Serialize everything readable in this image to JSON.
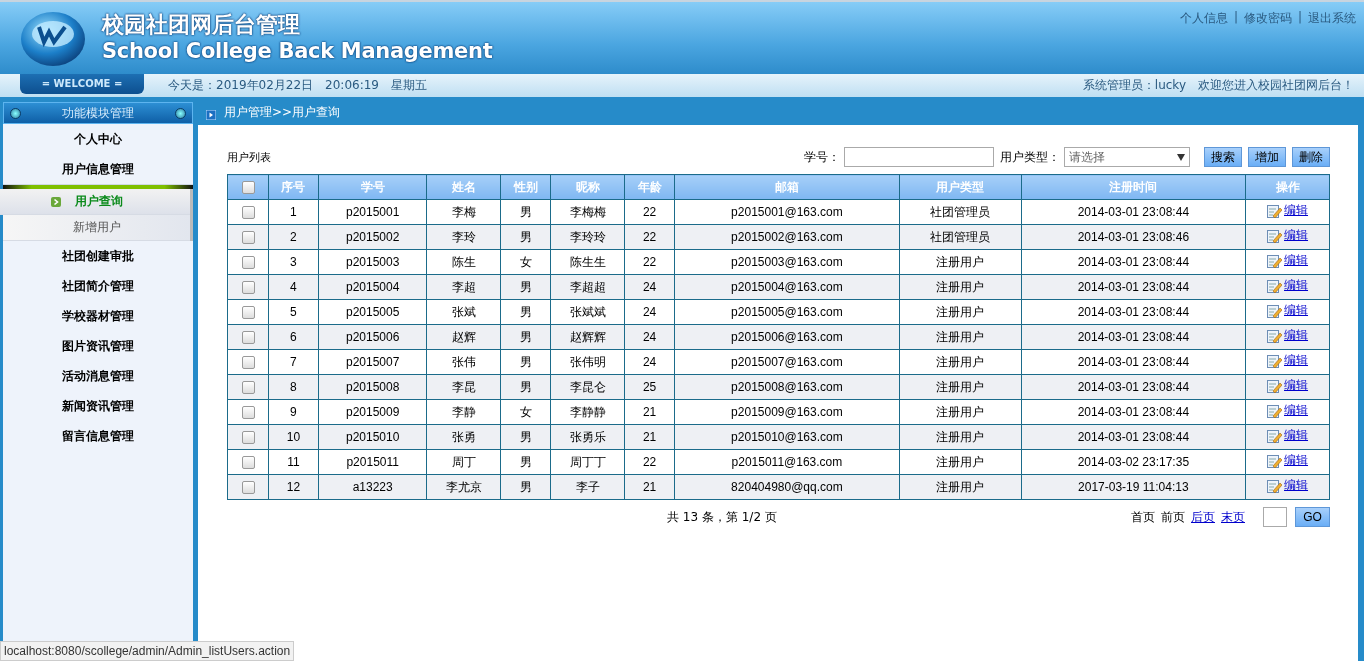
{
  "header": {
    "title_cn": "校园社团网后台管理",
    "title_en": "School College Back Management",
    "links": [
      "个人信息",
      "修改密码",
      "退出系统"
    ],
    "separator": "|"
  },
  "info_bar": {
    "welcome": "= WELCOME =",
    "date": "今天是：2019年02月22日　20:06:19　星期五",
    "user": "系统管理员：lucky　欢迎您进入校园社团网后台！"
  },
  "sidebar": {
    "title": "功能模块管理",
    "items": [
      {
        "label": "个人中心",
        "expanded": false
      },
      {
        "label": "用户信息管理",
        "expanded": true,
        "children": [
          {
            "label": "用户查询",
            "selected": true
          },
          {
            "label": "新增用户",
            "selected": false
          }
        ]
      },
      {
        "label": "社团创建审批",
        "expanded": false
      },
      {
        "label": "社团简介管理",
        "expanded": false
      },
      {
        "label": "学校器材管理",
        "expanded": false
      },
      {
        "label": "图片资讯管理",
        "expanded": false
      },
      {
        "label": "活动消息管理",
        "expanded": false
      },
      {
        "label": "新闻资讯管理",
        "expanded": false
      },
      {
        "label": "留言信息管理",
        "expanded": false
      }
    ]
  },
  "breadcrumb": "用户管理>>用户查询",
  "list_title": "用户列表",
  "search": {
    "id_label": "学号：",
    "type_label": "用户类型：",
    "type_placeholder": "请选择",
    "buttons": [
      "搜索",
      "增加",
      "删除"
    ]
  },
  "table": {
    "select_all_checked": false,
    "columns": [
      "序号",
      "学号",
      "姓名",
      "性别",
      "昵称",
      "年龄",
      "邮箱",
      "用户类型",
      "注册时间",
      "操作"
    ],
    "rows": [
      {
        "checked": false,
        "cells": [
          "1",
          "p2015001",
          "李梅",
          "男",
          "李梅梅",
          "22",
          "p2015001@163.com",
          "社团管理员",
          "2014-03-01 23:08:44"
        ],
        "action": "编辑"
      },
      {
        "checked": false,
        "cells": [
          "2",
          "p2015002",
          "李玲",
          "男",
          "李玲玲",
          "22",
          "p2015002@163.com",
          "社团管理员",
          "2014-03-01 23:08:46"
        ],
        "action": "编辑"
      },
      {
        "checked": false,
        "cells": [
          "3",
          "p2015003",
          "陈生",
          "女",
          "陈生生",
          "22",
          "p2015003@163.com",
          "注册用户",
          "2014-03-01 23:08:44"
        ],
        "action": "编辑"
      },
      {
        "checked": false,
        "cells": [
          "4",
          "p2015004",
          "李超",
          "男",
          "李超超",
          "24",
          "p2015004@163.com",
          "注册用户",
          "2014-03-01 23:08:44"
        ],
        "action": "编辑"
      },
      {
        "checked": false,
        "cells": [
          "5",
          "p2015005",
          "张斌",
          "男",
          "张斌斌",
          "24",
          "p2015005@163.com",
          "注册用户",
          "2014-03-01 23:08:44"
        ],
        "action": "编辑"
      },
      {
        "checked": false,
        "cells": [
          "6",
          "p2015006",
          "赵辉",
          "男",
          "赵辉辉",
          "24",
          "p2015006@163.com",
          "注册用户",
          "2014-03-01 23:08:44"
        ],
        "action": "编辑"
      },
      {
        "checked": false,
        "cells": [
          "7",
          "p2015007",
          "张伟",
          "男",
          "张伟明",
          "24",
          "p2015007@163.com",
          "注册用户",
          "2014-03-01 23:08:44"
        ],
        "action": "编辑"
      },
      {
        "checked": false,
        "cells": [
          "8",
          "p2015008",
          "李昆",
          "男",
          "李昆仑",
          "25",
          "p2015008@163.com",
          "注册用户",
          "2014-03-01 23:08:44"
        ],
        "action": "编辑"
      },
      {
        "checked": false,
        "cells": [
          "9",
          "p2015009",
          "李静",
          "女",
          "李静静",
          "21",
          "p2015009@163.com",
          "注册用户",
          "2014-03-01 23:08:44"
        ],
        "action": "编辑"
      },
      {
        "checked": false,
        "cells": [
          "10",
          "p2015010",
          "张勇",
          "男",
          "张勇乐",
          "21",
          "p2015010@163.com",
          "注册用户",
          "2014-03-01 23:08:44"
        ],
        "action": "编辑"
      },
      {
        "checked": false,
        "cells": [
          "11",
          "p2015011",
          "周丁",
          "男",
          "周丁丁",
          "22",
          "p2015011@163.com",
          "注册用户",
          "2014-03-02 23:17:35"
        ],
        "action": "编辑"
      },
      {
        "checked": false,
        "cells": [
          "12",
          "a13223",
          "李尤京",
          "男",
          "李子",
          "21",
          "820404980@qq.com",
          "注册用户",
          "2017-03-19 11:04:13"
        ],
        "action": "编辑"
      }
    ]
  },
  "pagination": {
    "summary": "共 13 条，第 1/2 页",
    "links": [
      {
        "label": "首页",
        "disabled": true
      },
      {
        "label": "前页",
        "disabled": true
      },
      {
        "label": "后页",
        "disabled": false
      },
      {
        "label": "末页",
        "disabled": false
      }
    ],
    "go": "GO"
  },
  "status_bar": "localhost:8080/scollege/admin/Admin_listUsers.action"
}
